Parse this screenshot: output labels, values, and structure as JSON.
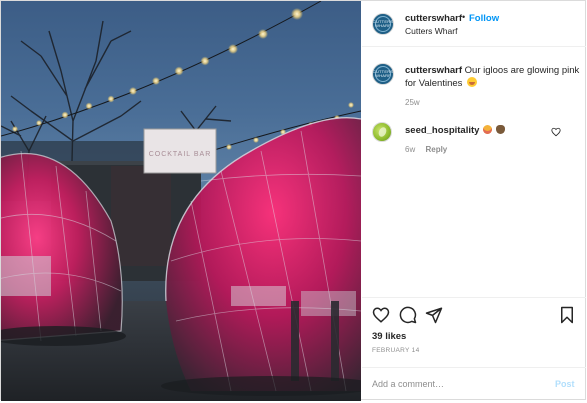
{
  "header": {
    "username": "cutterswharf",
    "separator": "•",
    "follow_label": "Follow",
    "location": "Cutters Wharf",
    "avatar_text": "CUTTERS WHARF"
  },
  "photo": {
    "sign_text": "COCKTAIL BAR"
  },
  "caption": {
    "username": "cutterswharf",
    "text": "Our igloos are glowing pink for Valentines",
    "time": "25w"
  },
  "comments": [
    {
      "username": "seed_hospitality",
      "time": "6w",
      "reply_label": "Reply"
    }
  ],
  "actions": {
    "icons": [
      "heart-icon",
      "comment-icon",
      "share-icon",
      "bookmark-icon"
    ],
    "likes": "39 likes",
    "date": "FEBRUARY 14"
  },
  "add_comment": {
    "placeholder": "Add a comment…",
    "post_label": "Post"
  },
  "colors": {
    "accent": "#0095f6",
    "post_disabled": "#b2dffc",
    "igloo_glow": "#e8206a"
  }
}
